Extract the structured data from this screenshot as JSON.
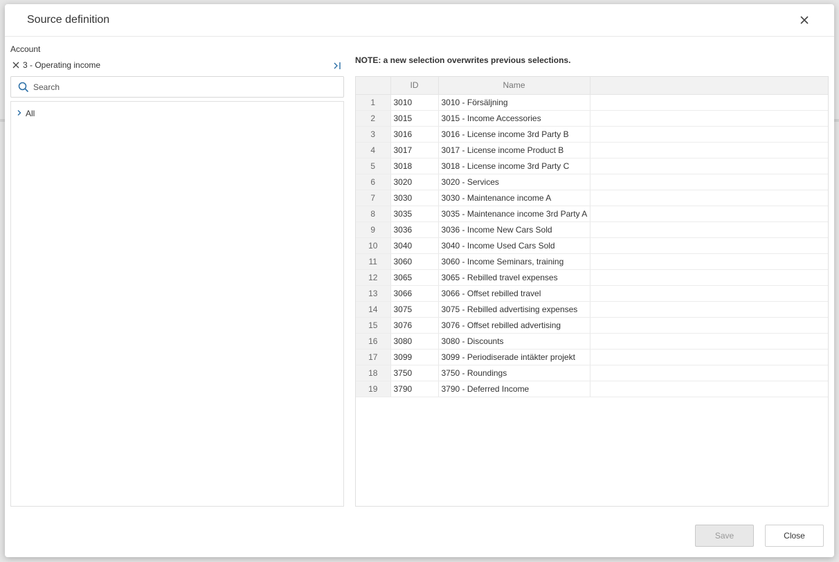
{
  "dialog": {
    "title": "Source definition"
  },
  "account": {
    "label": "Account",
    "selected": "3 - Operating income"
  },
  "search": {
    "placeholder": "Search",
    "value": ""
  },
  "tree": {
    "items": [
      {
        "label": "All"
      }
    ]
  },
  "note": "NOTE: a new selection overwrites previous selections.",
  "grid": {
    "columns": {
      "id": "ID",
      "name": "Name"
    },
    "rows": [
      {
        "num": "1",
        "id": "3010",
        "name": "3010 - Försäljning"
      },
      {
        "num": "2",
        "id": "3015",
        "name": "3015 - Income Accessories"
      },
      {
        "num": "3",
        "id": "3016",
        "name": "3016 - License income 3rd Party B"
      },
      {
        "num": "4",
        "id": "3017",
        "name": "3017 - License income Product B"
      },
      {
        "num": "5",
        "id": "3018",
        "name": "3018 - License income 3rd Party C"
      },
      {
        "num": "6",
        "id": "3020",
        "name": "3020 - Services"
      },
      {
        "num": "7",
        "id": "3030",
        "name": "3030 - Maintenance income A"
      },
      {
        "num": "8",
        "id": "3035",
        "name": "3035 - Maintenance income 3rd Party A"
      },
      {
        "num": "9",
        "id": "3036",
        "name": "3036 - Income New Cars Sold"
      },
      {
        "num": "10",
        "id": "3040",
        "name": "3040 - Income Used Cars Sold"
      },
      {
        "num": "11",
        "id": "3060",
        "name": "3060 - Income Seminars, training"
      },
      {
        "num": "12",
        "id": "3065",
        "name": "3065 - Rebilled travel expenses"
      },
      {
        "num": "13",
        "id": "3066",
        "name": "3066 - Offset rebilled travel"
      },
      {
        "num": "14",
        "id": "3075",
        "name": "3075 - Rebilled advertising expenses"
      },
      {
        "num": "15",
        "id": "3076",
        "name": "3076 - Offset rebilled advertising"
      },
      {
        "num": "16",
        "id": "3080",
        "name": "3080 - Discounts"
      },
      {
        "num": "17",
        "id": "3099",
        "name": "3099 - Periodiserade intäkter projekt"
      },
      {
        "num": "18",
        "id": "3750",
        "name": "3750 - Roundings"
      },
      {
        "num": "19",
        "id": "3790",
        "name": "3790 - Deferred Income"
      }
    ]
  },
  "footer": {
    "save_label": "Save",
    "close_label": "Close"
  },
  "colors": {
    "accent": "#2a6ea6",
    "disabled_bg": "#e8e8e8",
    "header_bg": "#f2f2f2"
  },
  "icons": {
    "close": "close-icon",
    "remove": "remove-selection-icon",
    "collapse": "collapse-right-icon",
    "search": "search-icon",
    "tree": "chevron-right-icon"
  }
}
